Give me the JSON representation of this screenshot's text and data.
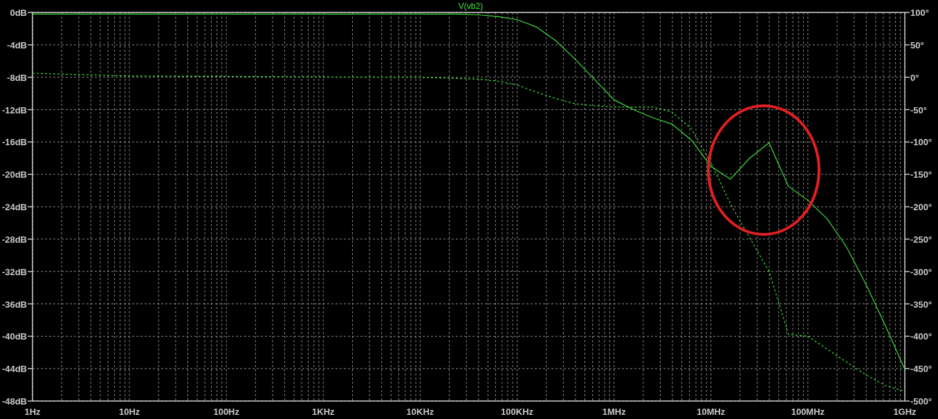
{
  "plot": {
    "chart_data": {
      "type": "line",
      "title": "V(vb2)",
      "categories": [
        "1Hz",
        null,
        null,
        null,
        null,
        "10Hz",
        null,
        null,
        null,
        null,
        "100Hz",
        null,
        null,
        null,
        null,
        "1KHz",
        null,
        null,
        null,
        null,
        "10KHz",
        null,
        null,
        null,
        null,
        "100KHz",
        null,
        null,
        null,
        null,
        "1MHz",
        null,
        null,
        null,
        null,
        "10MHz",
        null,
        null,
        null,
        null,
        "100MHz",
        null,
        null,
        null,
        null,
        "1GHz"
      ],
      "series": [
        {
          "color": "#3ee03e",
          "values": [
            -0.2,
            -0.2,
            -0.2,
            -0.2,
            -0.2,
            -0.2,
            -0.2,
            -0.2,
            -0.2,
            -0.2,
            -0.2,
            -0.2,
            -0.2,
            -0.2,
            -0.2,
            -0.2,
            -0.2,
            -0.2,
            -0.2,
            -0.2,
            -0.2,
            -0.2,
            -0.2,
            -0.3,
            -0.5,
            -0.9,
            -1.8,
            -3.5,
            -5.8,
            -8.3,
            -10.8,
            -12,
            -13,
            -13.8,
            -15.8,
            -19,
            -20.6,
            -18,
            -16.1,
            -21.5,
            -23.2,
            -25.5,
            -29,
            -33.6,
            -38.7,
            -44.1
          ]
        },
        {
          "color": "#3ee03e",
          "axis": "y2",
          "line_style": "dashed",
          "values": [
            6,
            5.2,
            4.4,
            3.6,
            2.8,
            2,
            1.8,
            1.6,
            1.4,
            1.3,
            1.2,
            1.1,
            1,
            0.8,
            0.6,
            0.5,
            0.4,
            0.3,
            0.2,
            0.1,
            0,
            -1,
            -2,
            -3,
            -6,
            -12,
            -23,
            -33,
            -41,
            -44,
            -46,
            -46,
            -46,
            -54,
            -80,
            -132,
            -195,
            -248,
            -300,
            -397,
            -400,
            -420,
            -440,
            -460,
            -476,
            -485
          ]
        }
      ],
      "grid": true,
      "ylim": [
        -48,
        0
      ],
      "y2lim": [
        -500,
        100
      ],
      "y2ticks": [
        {
          "value": 100,
          "label": "100°"
        },
        {
          "value": 50,
          "label": "50°"
        },
        {
          "value": 0,
          "label": "0°"
        },
        {
          "value": -50,
          "label": "-50°"
        },
        {
          "value": -100,
          "label": "-100°"
        },
        {
          "value": -150,
          "label": "-150°"
        },
        {
          "value": -200,
          "label": "-200°"
        },
        {
          "value": -250,
          "label": "-250°"
        },
        {
          "value": -300,
          "label": "-300°"
        },
        {
          "value": -350,
          "label": "-350°"
        },
        {
          "value": -400,
          "label": "-400°"
        },
        {
          "value": -450,
          "label": "-450°"
        },
        {
          "value": -500,
          "label": "-500°"
        }
      ],
      "yticks": [
        {
          "value": 0,
          "label": "0dB"
        },
        {
          "value": -4,
          "label": "-4dB"
        },
        {
          "value": -8,
          "label": "-8dB"
        },
        {
          "value": -12,
          "label": "-12dB"
        },
        {
          "value": -16,
          "label": "-16dB"
        },
        {
          "value": -20,
          "label": "-20dB"
        },
        {
          "value": -24,
          "label": "-24dB"
        },
        {
          "value": -28,
          "label": "-28dB"
        },
        {
          "value": -32,
          "label": "-32dB"
        },
        {
          "value": -36,
          "label": "-36dB"
        },
        {
          "value": -40,
          "label": "-40dB"
        },
        {
          "value": -44,
          "label": "-44dB"
        },
        {
          "value": -48,
          "label": "-48dB"
        }
      ]
    }
  }
}
